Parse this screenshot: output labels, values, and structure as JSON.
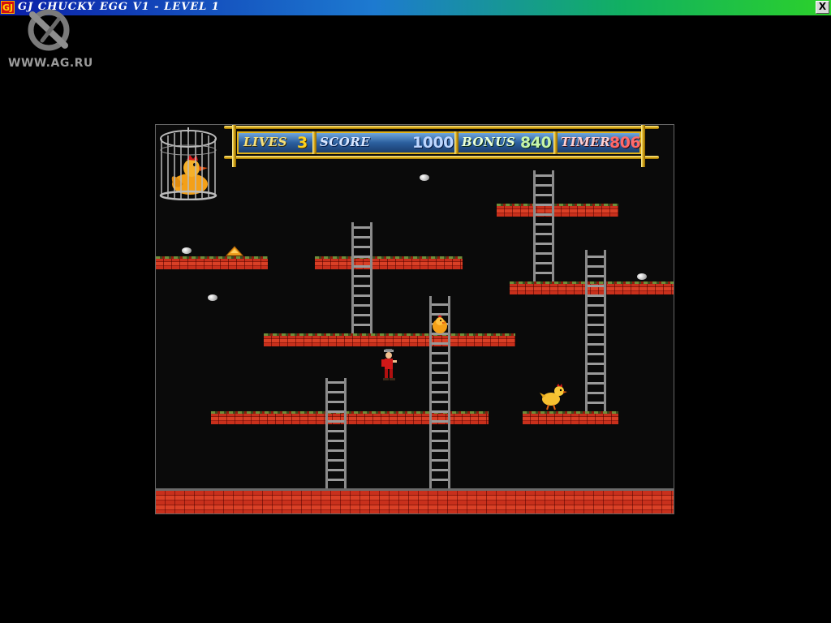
{
  "window": {
    "title": "GJ CHUCKY EGG V1 - LEVEL 1",
    "app_icon_text": "GJ",
    "close_label": "X"
  },
  "watermark": {
    "text": "WWW.AG.RU"
  },
  "hud": {
    "lives": {
      "label": "LIVES",
      "value": "3"
    },
    "score": {
      "label": "SCORE",
      "value": "1000"
    },
    "bonus": {
      "label": "BONUS",
      "value": "840"
    },
    "timer": {
      "label": "TIMER",
      "value": "806"
    }
  },
  "colors": {
    "brick": "#c8301c",
    "moss": "#4e6a2a",
    "ladder": "#8a8a8a",
    "hud_gold": "#e0b018",
    "hud_blue": "#2b5f9e"
  },
  "sprites": [
    "caged-duck",
    "player-farmer",
    "hen",
    "chick",
    "seed",
    "egg",
    "grain-pile"
  ]
}
